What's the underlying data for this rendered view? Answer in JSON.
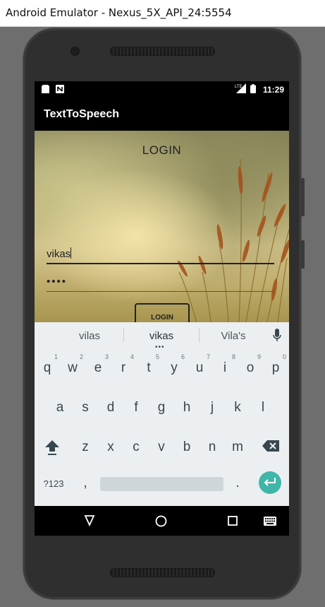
{
  "window": {
    "title": "Android Emulator - Nexus_5X_API_24:5554"
  },
  "status_bar": {
    "time": "11:29",
    "network": "LTE"
  },
  "app": {
    "title": "TextToSpeech"
  },
  "login": {
    "heading": "LOGIN",
    "username_value": "vikas",
    "password_value": "••••",
    "button_label": "LOGIN"
  },
  "keyboard": {
    "suggestions": [
      "vilas",
      "vikas",
      "Vila's"
    ],
    "row1": [
      {
        "k": "q",
        "h": "1"
      },
      {
        "k": "w",
        "h": "2"
      },
      {
        "k": "e",
        "h": "3"
      },
      {
        "k": "r",
        "h": "4"
      },
      {
        "k": "t",
        "h": "5"
      },
      {
        "k": "y",
        "h": "6"
      },
      {
        "k": "u",
        "h": "7"
      },
      {
        "k": "i",
        "h": "8"
      },
      {
        "k": "o",
        "h": "9"
      },
      {
        "k": "p",
        "h": "0"
      }
    ],
    "row2": [
      "a",
      "s",
      "d",
      "f",
      "g",
      "h",
      "j",
      "k",
      "l"
    ],
    "row3": [
      "z",
      "x",
      "c",
      "v",
      "b",
      "n",
      "m"
    ],
    "symbols_label": "?123",
    "comma_label": ",",
    "period_label": "."
  },
  "colors": {
    "accent": "#40b6a8",
    "keyboard_bg": "#eceff1"
  }
}
